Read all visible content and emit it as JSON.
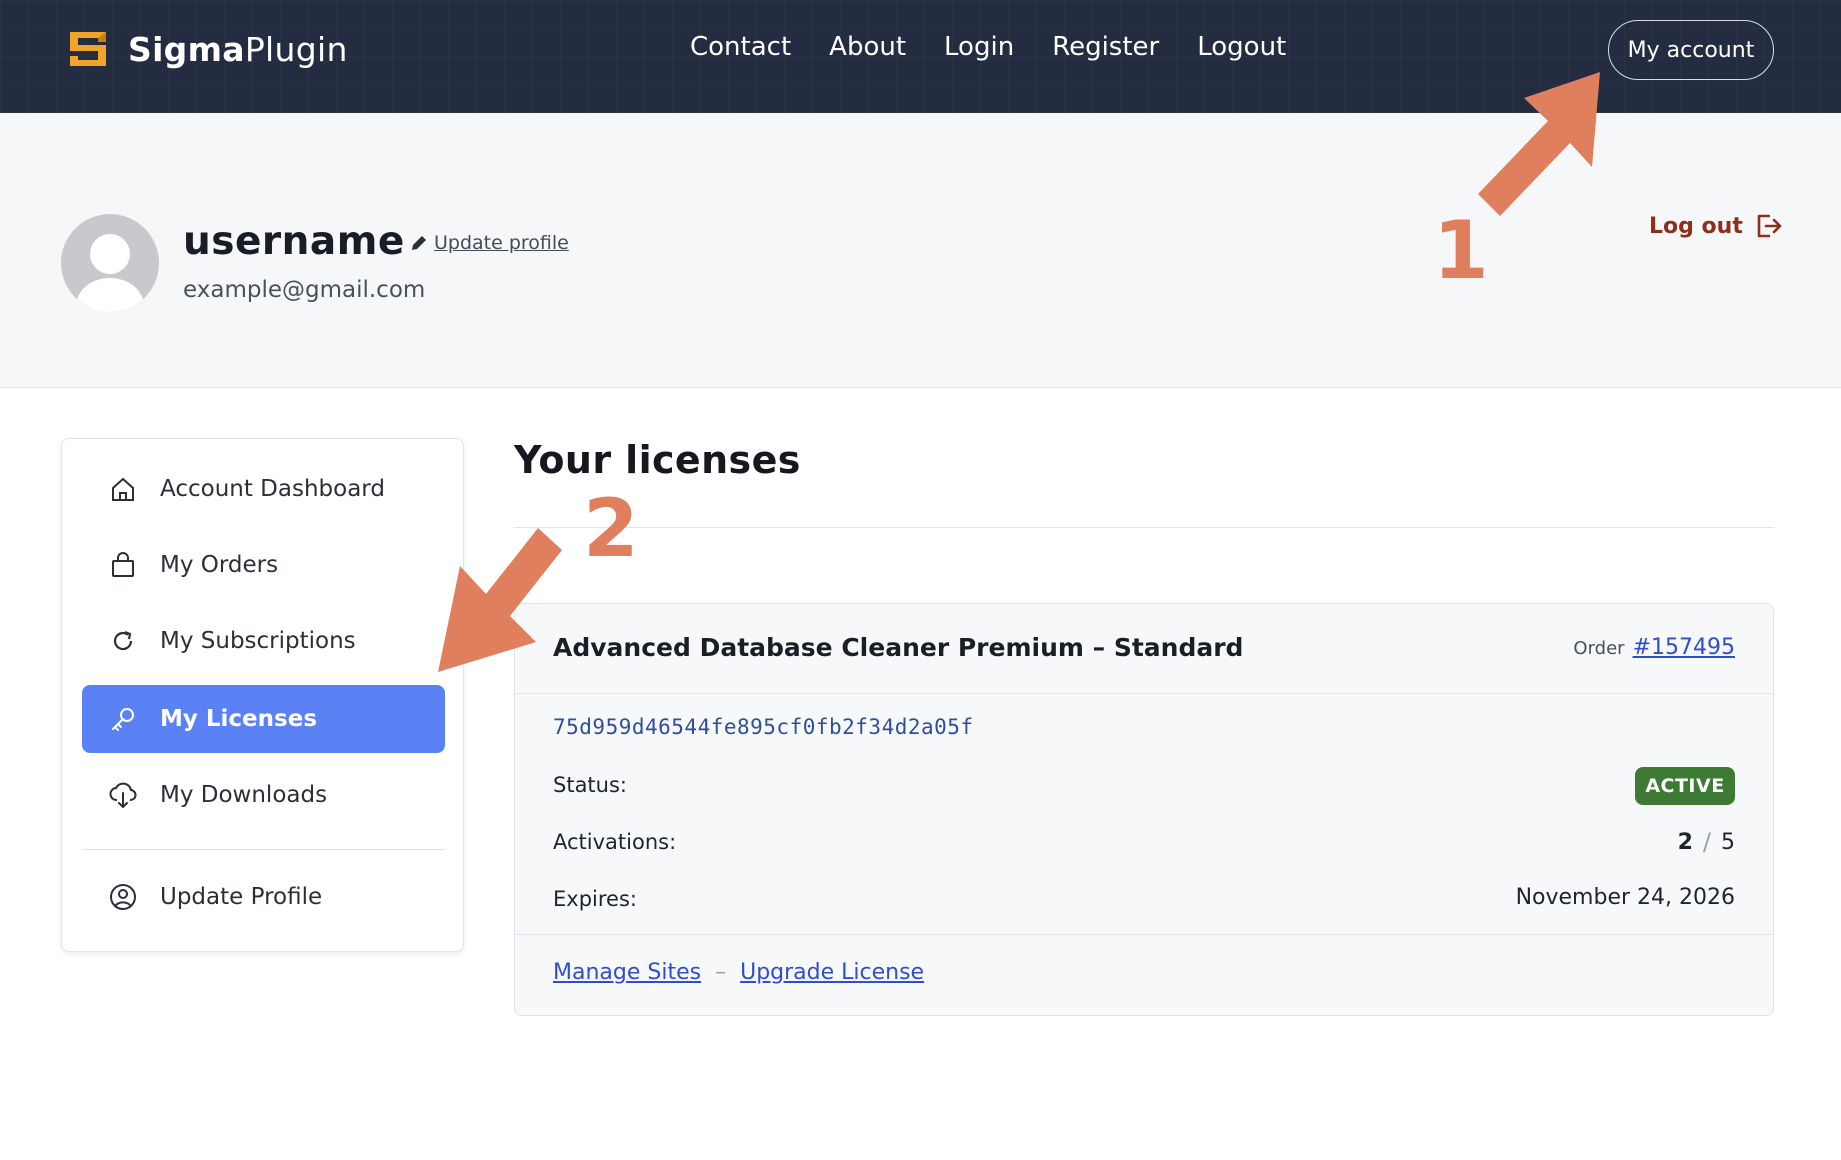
{
  "brand": {
    "name_bold": "Sigma",
    "name_regular": "Plugin",
    "accent": "#f0a52a"
  },
  "nav": {
    "links": [
      "Contact",
      "About",
      "Login",
      "Register",
      "Logout"
    ],
    "account_label": "My account"
  },
  "profile": {
    "username": "username",
    "update_link": "Update profile",
    "email": "example@gmail.com",
    "logout_label": "Log out"
  },
  "sidebar": {
    "items": [
      {
        "label": "Account Dashboard",
        "icon": "home-icon"
      },
      {
        "label": "My Orders",
        "icon": "bag-icon"
      },
      {
        "label": "My Subscriptions",
        "icon": "refresh-icon"
      },
      {
        "label": "My Licenses",
        "icon": "key-icon",
        "active": true
      },
      {
        "label": "My Downloads",
        "icon": "cloud-download-icon"
      },
      {
        "label": "Update Profile",
        "icon": "user-circle-icon"
      }
    ],
    "active_color": "#5b82f5"
  },
  "main": {
    "title": "Your licenses",
    "license": {
      "product": "Advanced Database Cleaner Premium – Standard",
      "order_prefix": "Order",
      "order_number": "#157495",
      "key": "75d959d46544fe895cf0fb2f34d2a05f",
      "status_label": "Status:",
      "status_value": "ACTIVE",
      "activations_label": "Activations:",
      "activations_used": "2",
      "activations_sep": "/",
      "activations_total": "5",
      "expires_label": "Expires:",
      "expires_value": "November 24, 2026",
      "manage_sites": "Manage Sites",
      "foot_sep": "–",
      "upgrade_license": "Upgrade License"
    }
  },
  "annotations": {
    "first": "1",
    "second": "2",
    "color": "#e07f5d"
  }
}
